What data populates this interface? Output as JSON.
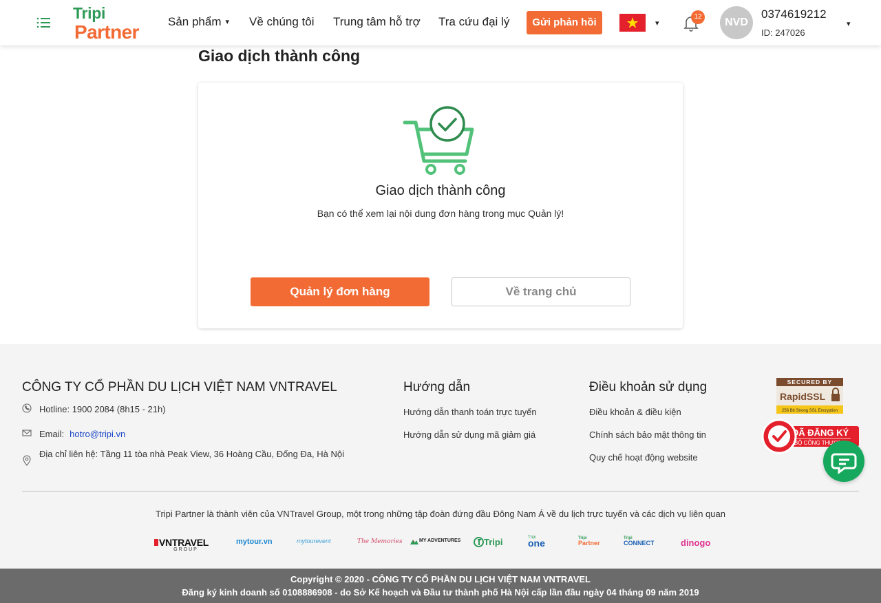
{
  "header": {
    "logo_top": "Tripi",
    "logo_bottom": "Partner",
    "nav": [
      "Sản phẩm",
      "Về chúng tôi",
      "Trung tâm hỗ trợ",
      "Tra cứu đại lý"
    ],
    "nav_caret": "▾",
    "feedback_label": "Gửi phản hồi",
    "language": "vi",
    "language_caret": "▾",
    "notification_count": "12",
    "avatar_initials": "NVD",
    "user_phone": "0374619212",
    "user_id": "ID: 247026",
    "user_caret": "▾",
    "colors": {
      "accent": "#f26b35",
      "brand_green": "#2e9a57"
    }
  },
  "main": {
    "page_title": "Giao dịch thành công",
    "card_title": "Giao dịch thành công",
    "card_subtitle": "Bạn có thể xem lại nội dung đơn hàng trong mục Quản lý!",
    "primary_button": "Quản lý đơn hàng",
    "secondary_button": "Về trang chủ",
    "icon": "cart-check-icon"
  },
  "footer": {
    "company_name": "CÔNG TY CỔ PHẦN DU LỊCH VIỆT NAM VNTRAVEL",
    "hotline": "Hotline: 1900 2084 (8h15 - 21h)",
    "email_label": "Email:",
    "email": "hotro@tripi.vn",
    "address": "Địa chỉ liên hệ: Tầng 11 tòa nhà Peak View, 36 Hoàng Cầu, Đống Đa, Hà Nội",
    "guide_title": "Hướng dẫn",
    "guide_links": [
      "Hướng dẫn thanh toán trực tuyến",
      "Hướng dẫn sử dụng mã giảm giá"
    ],
    "terms_title": "Điều khoản sử dụng",
    "terms_links": [
      "Điều khoản & điều kiện",
      "Chính sách bảo mật thông tin",
      "Quy chế hoạt động website"
    ],
    "ssl_badge": {
      "top": "SECURED BY",
      "brand": "RapidSSL",
      "sub": "256 Bit Strong SSL Encryption"
    },
    "bct_badge": {
      "line1": "ĐÃ ĐĂNG KÝ",
      "line2": "BỘ CÔNG THƯƠNG"
    },
    "member_text": "Tripi Partner là thành viên của VNTravel Group, một trong những tập đoàn đứng đầu Đông Nam Á về du lịch trực tuyến và các dịch vụ liên quan",
    "partners": [
      {
        "main": "VNTRAVEL",
        "sub": "GROUP"
      },
      {
        "main": "mytour.vn"
      },
      {
        "main": "mytourevent"
      },
      {
        "main": "The Memories"
      },
      {
        "main": "MY ADVENTURES"
      },
      {
        "main": "Tripi"
      },
      {
        "main": "one",
        "sub": "Tripi"
      },
      {
        "main": "Partner",
        "sub": "Tripi"
      },
      {
        "main": "CONNECT",
        "sub": "Tripi"
      },
      {
        "main": "dinogo"
      }
    ]
  },
  "copyright": {
    "line1": "Copyright © 2020 - CÔNG TY CỔ PHẦN DU LỊCH VIỆT NAM VNTRAVEL",
    "line2": "Đăng ký kinh doanh số 0108886908 - do Sở Kế hoạch và Đầu tư thành phố Hà Nội cấp lần đầu ngày 04 tháng 09 năm 2019"
  }
}
